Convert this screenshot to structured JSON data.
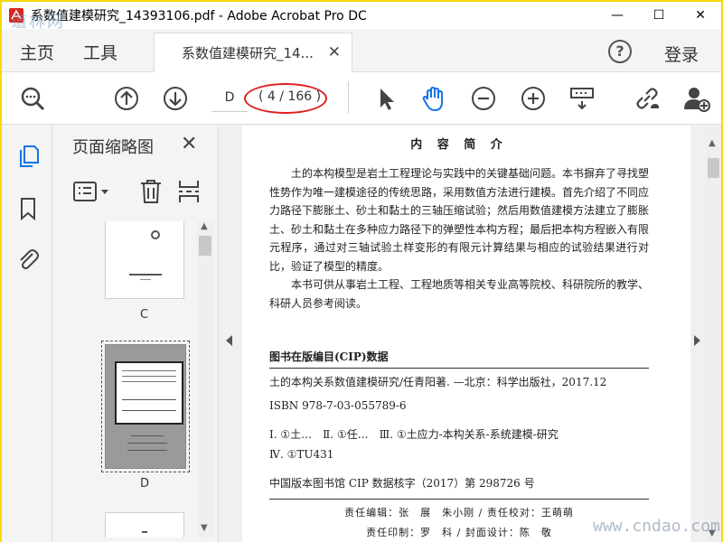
{
  "window": {
    "title": "系数值建模研究_14393106.pdf - Adobe Acrobat Pro DC",
    "minimize": "—",
    "maximize": "☐",
    "close": "✕",
    "watermark_top": "道林网"
  },
  "menubar": {
    "home": "主页",
    "tools": "工具",
    "doc_tab": "系数值建模研究_14...",
    "tab_close": "✕",
    "help": "?",
    "login": "登录"
  },
  "toolbar": {
    "page_label": "D",
    "page_count": "( 4 / 166 )",
    "icons": [
      "zoom-search-icon",
      "page-up-icon",
      "page-down-icon",
      "select-arrow-icon",
      "hand-icon",
      "zoom-out-icon",
      "zoom-in-icon",
      "page-tools-icon",
      "share-link-icon",
      "add-user-icon"
    ],
    "accent": "#1473e6",
    "highlight_color": "#e02020"
  },
  "left_rail": {
    "icons": [
      "page-thumbnails-icon",
      "bookmark-icon",
      "attachment-icon"
    ]
  },
  "thumbnails": {
    "title": "页面缩略图",
    "close": "✕",
    "pages": [
      {
        "label": "C",
        "selected": false
      },
      {
        "label": "D",
        "selected": true
      }
    ]
  },
  "document": {
    "heading": "内 容 简 介",
    "paragraphs": [
      "土的本构模型是岩土工程理论与实践中的关键基础问题。本书摒弃了寻找塑性势作为唯一建模途径的传统思路，采用数值方法进行建模。首先介绍了不同应力路径下膨胀土、砂土和黏土的三轴压缩试验；然后用数值建模方法建立了膨胀土、砂土和黏土在多种应力路径下的弹塑性本构方程；最后把本构方程嵌入有限元程序，通过对三轴试验土样变形的有限元计算结果与相应的试验结果进行对比，验证了模型的精度。",
      "本书可供从事岩土工程、工程地质等相关专业高等院校、科研院所的教学、科研人员参考阅读。"
    ],
    "cip_header": "图书在版编目(CIP)数据",
    "cip_lines": [
      "土的本构关系数值建模研究/任青阳著. —北京：科学出版社，2017.12",
      "ISBN 978-7-03-055789-6",
      "Ⅰ. ①土…　Ⅱ. ①任…　Ⅲ. ①土应力-本构关系-系统建模-研究",
      "Ⅳ. ①TU431"
    ],
    "cip_number": "中国版本图书馆 CIP 数据核字（2017）第 298726 号",
    "credits": [
      "责任编辑：张　展　朱小刚 / 责任校对：王萌萌",
      "责任印制：罗　科 / 封面设计：陈　敬"
    ]
  },
  "watermark_bottom": "www.cndao.com"
}
